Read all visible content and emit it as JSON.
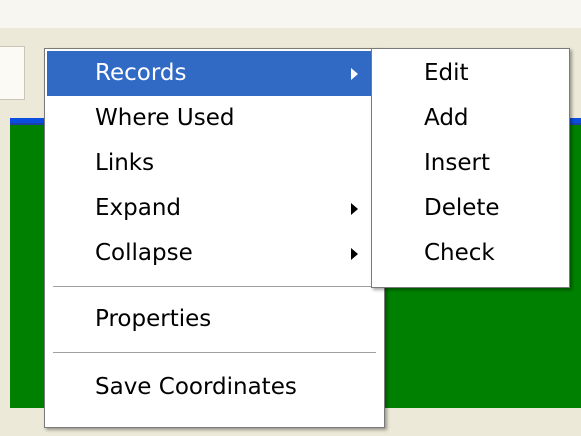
{
  "colors": {
    "pane_background": "#008000",
    "pane_border": "#0a4ee0",
    "highlight": "#316ac5",
    "menu_background": "#ffffff"
  },
  "context_menu": {
    "items": [
      {
        "label": "Records",
        "has_submenu": true,
        "highlighted": true
      },
      {
        "label": "Where Used",
        "has_submenu": false
      },
      {
        "label": "Links",
        "has_submenu": false
      },
      {
        "label": "Expand",
        "has_submenu": true
      },
      {
        "label": "Collapse",
        "has_submenu": true
      },
      {
        "label": "Properties",
        "has_submenu": false
      },
      {
        "label": "Save Coordinates",
        "has_submenu": false
      }
    ]
  },
  "records_submenu": {
    "items": [
      {
        "label": "Edit"
      },
      {
        "label": "Add"
      },
      {
        "label": "Insert"
      },
      {
        "label": "Delete"
      },
      {
        "label": "Check"
      }
    ]
  }
}
